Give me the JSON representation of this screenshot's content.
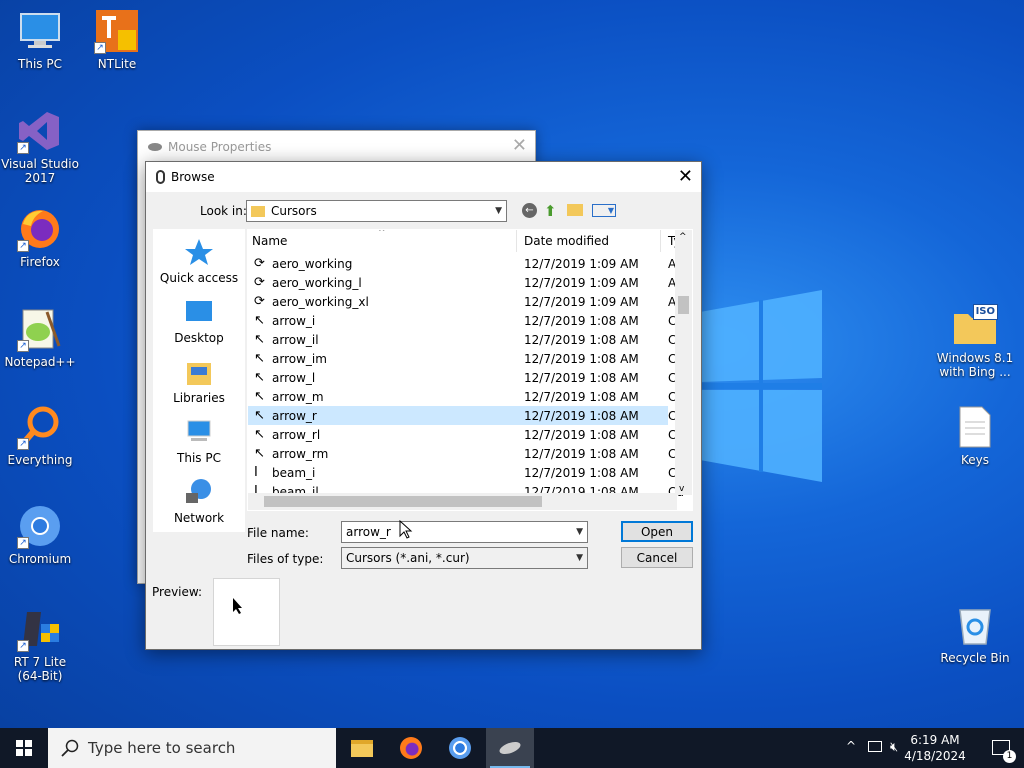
{
  "desktop": {
    "icons_left": [
      {
        "label": "This PC"
      },
      {
        "label": "NTLite"
      },
      {
        "label": "Visual Studio 2017"
      },
      {
        "label": "Firefox"
      },
      {
        "label": "Notepad++"
      },
      {
        "label": "Everything"
      },
      {
        "label": "Chromium"
      },
      {
        "label": "RT 7 Lite (64-Bit)"
      }
    ],
    "icons_right": [
      {
        "label": "Windows 8.1 with Bing ..."
      },
      {
        "label": "Keys"
      },
      {
        "label": "Recycle Bin"
      }
    ],
    "iso_badge": "ISO"
  },
  "mouse_window": {
    "title": "Mouse Properties"
  },
  "browse": {
    "title": "Browse",
    "look_in_label": "Look in:",
    "look_in_value": "Cursors",
    "places": [
      {
        "label": "Quick access"
      },
      {
        "label": "Desktop"
      },
      {
        "label": "Libraries"
      },
      {
        "label": "This PC"
      },
      {
        "label": "Network"
      }
    ],
    "columns": {
      "name": "Name",
      "date": "Date modified",
      "type": "Ty"
    },
    "files": [
      {
        "name": "aero_working",
        "date": "12/7/2019 1:09 AM",
        "type": "Ar"
      },
      {
        "name": "aero_working_l",
        "date": "12/7/2019 1:09 AM",
        "type": "Ar"
      },
      {
        "name": "aero_working_xl",
        "date": "12/7/2019 1:09 AM",
        "type": "Ar"
      },
      {
        "name": "arrow_i",
        "date": "12/7/2019 1:08 AM",
        "type": "Cu"
      },
      {
        "name": "arrow_il",
        "date": "12/7/2019 1:08 AM",
        "type": "Cu"
      },
      {
        "name": "arrow_im",
        "date": "12/7/2019 1:08 AM",
        "type": "Cu"
      },
      {
        "name": "arrow_l",
        "date": "12/7/2019 1:08 AM",
        "type": "Cu"
      },
      {
        "name": "arrow_m",
        "date": "12/7/2019 1:08 AM",
        "type": "Cu"
      },
      {
        "name": "arrow_r",
        "date": "12/7/2019 1:08 AM",
        "type": "Cu"
      },
      {
        "name": "arrow_rl",
        "date": "12/7/2019 1:08 AM",
        "type": "Cu"
      },
      {
        "name": "arrow_rm",
        "date": "12/7/2019 1:08 AM",
        "type": "Cu"
      },
      {
        "name": "beam_i",
        "date": "12/7/2019 1:08 AM",
        "type": "Cu"
      },
      {
        "name": "beam_il",
        "date": "12/7/2019 1:08 AM",
        "type": "Cu"
      }
    ],
    "selected_index": 8,
    "file_name_label": "File name:",
    "file_name_value": "arrow_r",
    "files_of_type_label": "Files of type:",
    "files_of_type_value": "Cursors (*.ani, *.cur)",
    "open_button": "Open",
    "cancel_button": "Cancel",
    "preview_label": "Preview:"
  },
  "taskbar": {
    "search_placeholder": "Type here to search",
    "time": "6:19 AM",
    "date": "4/18/2024",
    "notification_count": "1"
  },
  "colors": {
    "selection": "#cce8ff",
    "accent": "#0078d7",
    "taskbar": "#101827"
  }
}
